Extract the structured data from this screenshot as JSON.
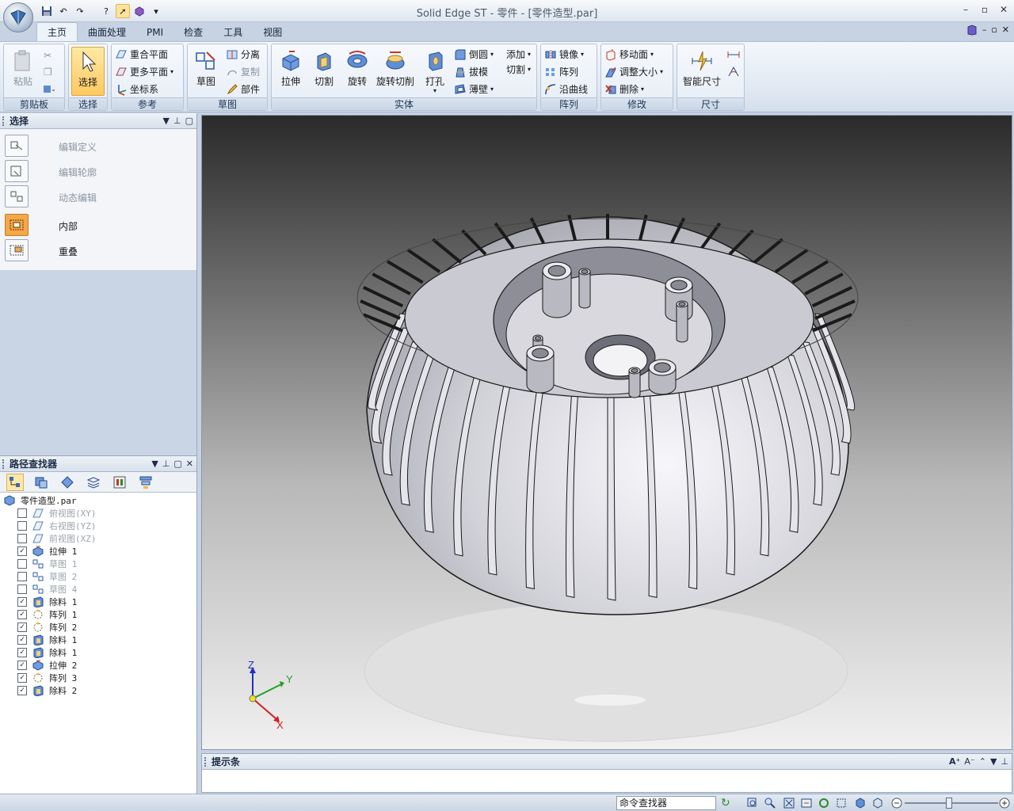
{
  "window": {
    "title": "Solid Edge ST - 零件 - [零件造型.par]"
  },
  "tabs": [
    "主页",
    "曲面处理",
    "PMI",
    "检查",
    "工具",
    "视图"
  ],
  "ribbon": {
    "clipboard": {
      "label": "剪贴板",
      "paste": "粘贴"
    },
    "select": {
      "label": "选择",
      "select": "选择"
    },
    "reference": {
      "label": "参考",
      "coincident_plane": "重合平面",
      "more_planes": "更多平面",
      "coordinate_system": "坐标系"
    },
    "sketch": {
      "label": "草图",
      "sketch": "草图",
      "split": "分离",
      "copy": "复制",
      "part": "部件"
    },
    "solids": {
      "label": "实体",
      "extrude": "拉伸",
      "cut": "切割",
      "revolve": "旋转",
      "revolve_cut": "旋转切削",
      "hole": "打孔",
      "round": "倒圆",
      "draft": "拔模",
      "thin_wall": "薄壁",
      "add": "添加",
      "cut2": "切割"
    },
    "pattern": {
      "label": "阵列",
      "mirror": "镜像",
      "pattern": "阵列",
      "along_curve": "沿曲线"
    },
    "modify": {
      "label": "修改",
      "move_face": "移动面",
      "resize": "调整大小",
      "delete": "删除"
    },
    "dimension": {
      "label": "尺寸",
      "smart_dimension": "智能尺寸"
    }
  },
  "select_panel": {
    "title": "选择",
    "items": [
      {
        "label": "编辑定义",
        "enabled": false
      },
      {
        "label": "编辑轮廓",
        "enabled": false
      },
      {
        "label": "动态编辑",
        "enabled": false
      },
      {
        "label": "内部",
        "enabled": true
      },
      {
        "label": "重叠",
        "enabled": true
      }
    ]
  },
  "pathfinder": {
    "title": "路径查找器",
    "root": "零件造型.par",
    "items": [
      {
        "label": "俯视图(XY)",
        "checked": false,
        "dim": true
      },
      {
        "label": "右视图(YZ)",
        "checked": false,
        "dim": true
      },
      {
        "label": "前视图(XZ)",
        "checked": false,
        "dim": true
      },
      {
        "label": "拉伸 1",
        "checked": true,
        "dim": false
      },
      {
        "label": "草图 1",
        "checked": false,
        "dim": true
      },
      {
        "label": "草图 2",
        "checked": false,
        "dim": true
      },
      {
        "label": "草图 4",
        "checked": false,
        "dim": true
      },
      {
        "label": "除料 1",
        "checked": true,
        "dim": false
      },
      {
        "label": "阵列 1",
        "checked": true,
        "dim": false
      },
      {
        "label": "阵列 2",
        "checked": true,
        "dim": false
      },
      {
        "label": "除料 1",
        "checked": true,
        "dim": false
      },
      {
        "label": "除料 1",
        "checked": true,
        "dim": false
      },
      {
        "label": "拉伸 2",
        "checked": true,
        "dim": false
      },
      {
        "label": "阵列 3",
        "checked": true,
        "dim": false
      },
      {
        "label": "除料 2",
        "checked": true,
        "dim": false
      }
    ]
  },
  "viewport": {
    "axes": {
      "z": "Z",
      "y": "Y",
      "x": "X"
    }
  },
  "prompt_bar": {
    "title": "提示条"
  },
  "status": {
    "command_finder": "命令查找器"
  }
}
